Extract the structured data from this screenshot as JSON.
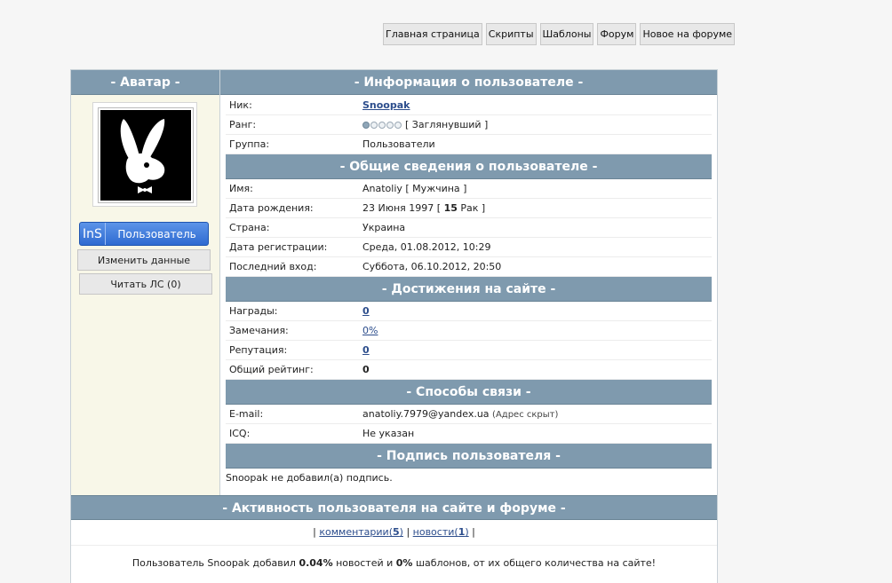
{
  "nav": [
    {
      "label": "Главная страница"
    },
    {
      "label": "Скрипты"
    },
    {
      "label": "Шаблоны"
    },
    {
      "label": "Форум"
    },
    {
      "label": "Новое на форуме"
    }
  ],
  "left": {
    "header": "- Аватар -",
    "badge_prefix": "InS",
    "badge_label": "Пользователь",
    "edit_button": "Изменить данные",
    "pm_button": "Читать ЛС (0)"
  },
  "info": {
    "header": "- Информация о пользователе -",
    "nick_label": "Ник:",
    "nick_value": "Snoopak",
    "rank_label": "Ранг:",
    "rank_value": "[ Заглянувший ]",
    "rank_level": 1,
    "rank_max": 5,
    "group_label": "Группа:",
    "group_value": "Пользователи"
  },
  "general": {
    "header": "- Общие сведения о пользователе -",
    "name_label": "Имя:",
    "name_value": "Anatoliy [ Мужчина ]",
    "birth_label": "Дата рождения:",
    "birth_date": "23 Июня 1997 [",
    "birth_age": "15",
    "birth_sign": "Рак ]",
    "country_label": "Страна:",
    "country_value": "Украина",
    "reg_label": "Дата регистрации:",
    "reg_value": "Среда, 01.08.2012, 10:29",
    "last_label": "Последний вход:",
    "last_value": "Суббота, 06.10.2012, 20:50"
  },
  "achievements": {
    "header": "- Достижения на сайте -",
    "awards_label": "Награды:",
    "awards_value": "0",
    "warnings_label": "Замечания:",
    "warnings_value": "0%",
    "rep_label": "Репутация:",
    "rep_value": "0",
    "rating_label": "Общий рейтинг:",
    "rating_value": "0"
  },
  "contacts": {
    "header": "- Способы связи -",
    "email_label": "E-mail:",
    "email_value": "anatoliy.7979@yandex.ua",
    "email_note": "(Адрес скрыт)",
    "icq_label": "ICQ:",
    "icq_value": "Не указан"
  },
  "signature": {
    "header": "- Подпись пользователя -",
    "text": "Snoopak не добавил(а) подпись."
  },
  "activity": {
    "header": "- Активность пользователя на сайте и форуме -",
    "comments_label": "комментарии",
    "comments_count": "5",
    "news_label": "новости",
    "news_count": "1",
    "stats_prefix": "Пользователь Snoopak добавил",
    "news_percent": "0.04%",
    "stats_mid": "новостей и",
    "templates_percent": "0%",
    "stats_suffix": "шаблонов, от их общего количества на сайте!"
  },
  "colors": {
    "header_bg": "#7f9aae",
    "link": "#2c4d8c",
    "badge_blue": "#2f6bd1",
    "left_bg": "#f8f7e8"
  }
}
